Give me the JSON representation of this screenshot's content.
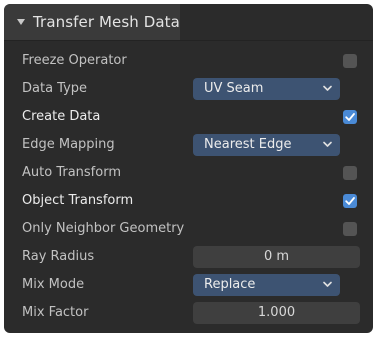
{
  "panel": {
    "title": "Transfer Mesh Data"
  },
  "rows": {
    "freeze_operator": {
      "label": "Freeze Operator",
      "checked": false
    },
    "data_type": {
      "label": "Data Type",
      "value": "UV Seam"
    },
    "create_data": {
      "label": "Create Data",
      "checked": true
    },
    "edge_mapping": {
      "label": "Edge Mapping",
      "value": "Nearest Edge"
    },
    "auto_transform": {
      "label": "Auto Transform",
      "checked": false
    },
    "object_transform": {
      "label": "Object Transform",
      "checked": true
    },
    "only_neighbor_geometry": {
      "label": "Only Neighbor Geometry",
      "checked": false
    },
    "ray_radius": {
      "label": "Ray Radius",
      "value": "0 m"
    },
    "mix_mode": {
      "label": "Mix Mode",
      "value": "Replace"
    },
    "mix_factor": {
      "label": "Mix Factor",
      "value": "1.000"
    }
  },
  "icons": {
    "panel_toggle": "triangle-down-icon",
    "dropdown": "chevron-down-icon",
    "check": "checkmark-icon"
  },
  "colors": {
    "panel_bg": "#2b2b2b",
    "header_bg": "#3a3a3a",
    "checkbox_on": "#4a8ad6",
    "checkbox_off": "#545454",
    "dropdown_bg": "#3d5372",
    "field_bg": "#3f3f3f"
  }
}
